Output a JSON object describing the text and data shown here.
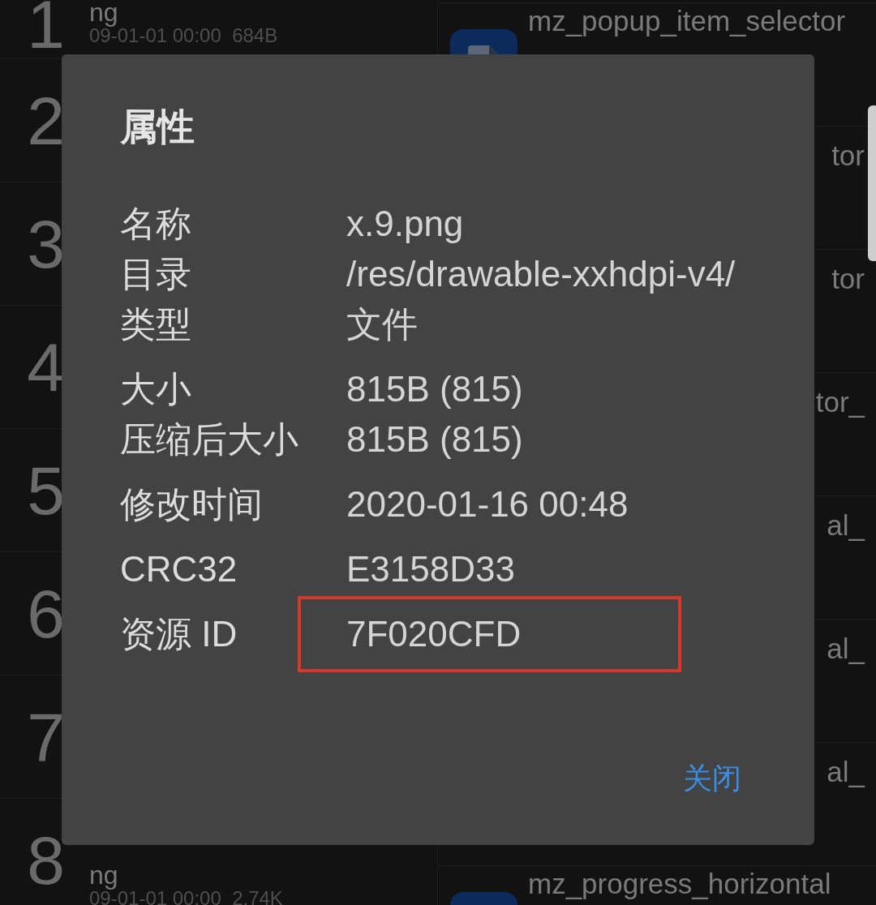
{
  "file_list": {
    "rows": [
      {
        "number": "1",
        "name": "ng",
        "meta": "09-01-01 00:00  684B"
      },
      {
        "number": "2"
      },
      {
        "number": "3"
      },
      {
        "number": "4"
      },
      {
        "number": "5"
      },
      {
        "number": "6"
      },
      {
        "number": "7"
      },
      {
        "number": "8",
        "name": "ng",
        "meta": "09-01-01 00:00  2.74K"
      }
    ]
  },
  "resource_list": {
    "rows": [
      {
        "kind": "entry",
        "name": "mz_popup_item_selector"
      },
      {
        "kind": "tail",
        "name": "tor"
      },
      {
        "kind": "tail",
        "name": "tor"
      },
      {
        "kind": "tail",
        "name": "tor_"
      },
      {
        "kind": "tail",
        "name": "al_"
      },
      {
        "kind": "tail",
        "name": "al_"
      },
      {
        "kind": "tail",
        "name": "al_"
      },
      {
        "kind": "entry",
        "name": "mz_progress_horizontal"
      }
    ]
  },
  "dialog": {
    "title": "属性",
    "sections": [
      [
        {
          "label": "名称",
          "value": "x.9.png",
          "highlighted": false
        },
        {
          "label": "目录",
          "value": "/res/drawable-xxhdpi-v4/",
          "highlighted": false
        },
        {
          "label": "类型",
          "value": "文件",
          "highlighted": false
        }
      ],
      [
        {
          "label": "大小",
          "value": "815B (815)",
          "highlighted": false
        },
        {
          "label": "压缩后大小",
          "value": "815B (815)",
          "highlighted": false
        }
      ],
      [
        {
          "label": "修改时间",
          "value": "2020-01-16 00:48",
          "highlighted": false
        }
      ],
      [
        {
          "label": "CRC32",
          "value": "E3158D33",
          "highlighted": false
        }
      ],
      [
        {
          "label": "资源 ID",
          "value": "7F020CFD",
          "highlighted": true
        }
      ]
    ],
    "close_button": "关闭"
  }
}
